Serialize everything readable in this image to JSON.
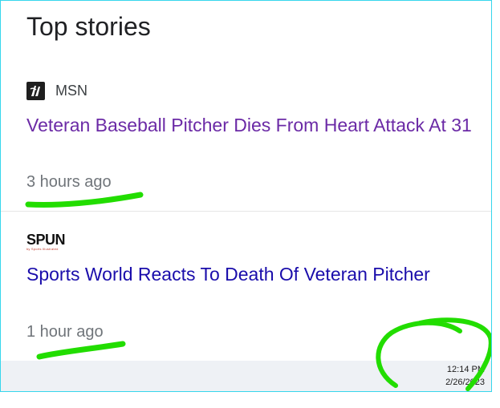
{
  "section": {
    "title": "Top stories"
  },
  "stories": [
    {
      "source": "MSN",
      "source_icon": "msn-logo-icon",
      "headline": "Veteran Baseball Pitcher Dies From Heart Attack At 31",
      "time": "3 hours ago"
    },
    {
      "source_logo_text": "SPUN",
      "source_logo_subtext": "by Sports Illustrated",
      "source_icon": "the-spun-logo-icon",
      "headline": "Sports World Reacts To Death Of Veteran Pitcher",
      "time": "1 hour ago"
    }
  ],
  "taskbar": {
    "time": "12:14 PM",
    "date": "2/26/2023"
  },
  "colors": {
    "frame_border": "#36d6ec",
    "visited_link": "#6b2aa6",
    "link": "#1a0dab",
    "annotation": "#22dd00"
  }
}
